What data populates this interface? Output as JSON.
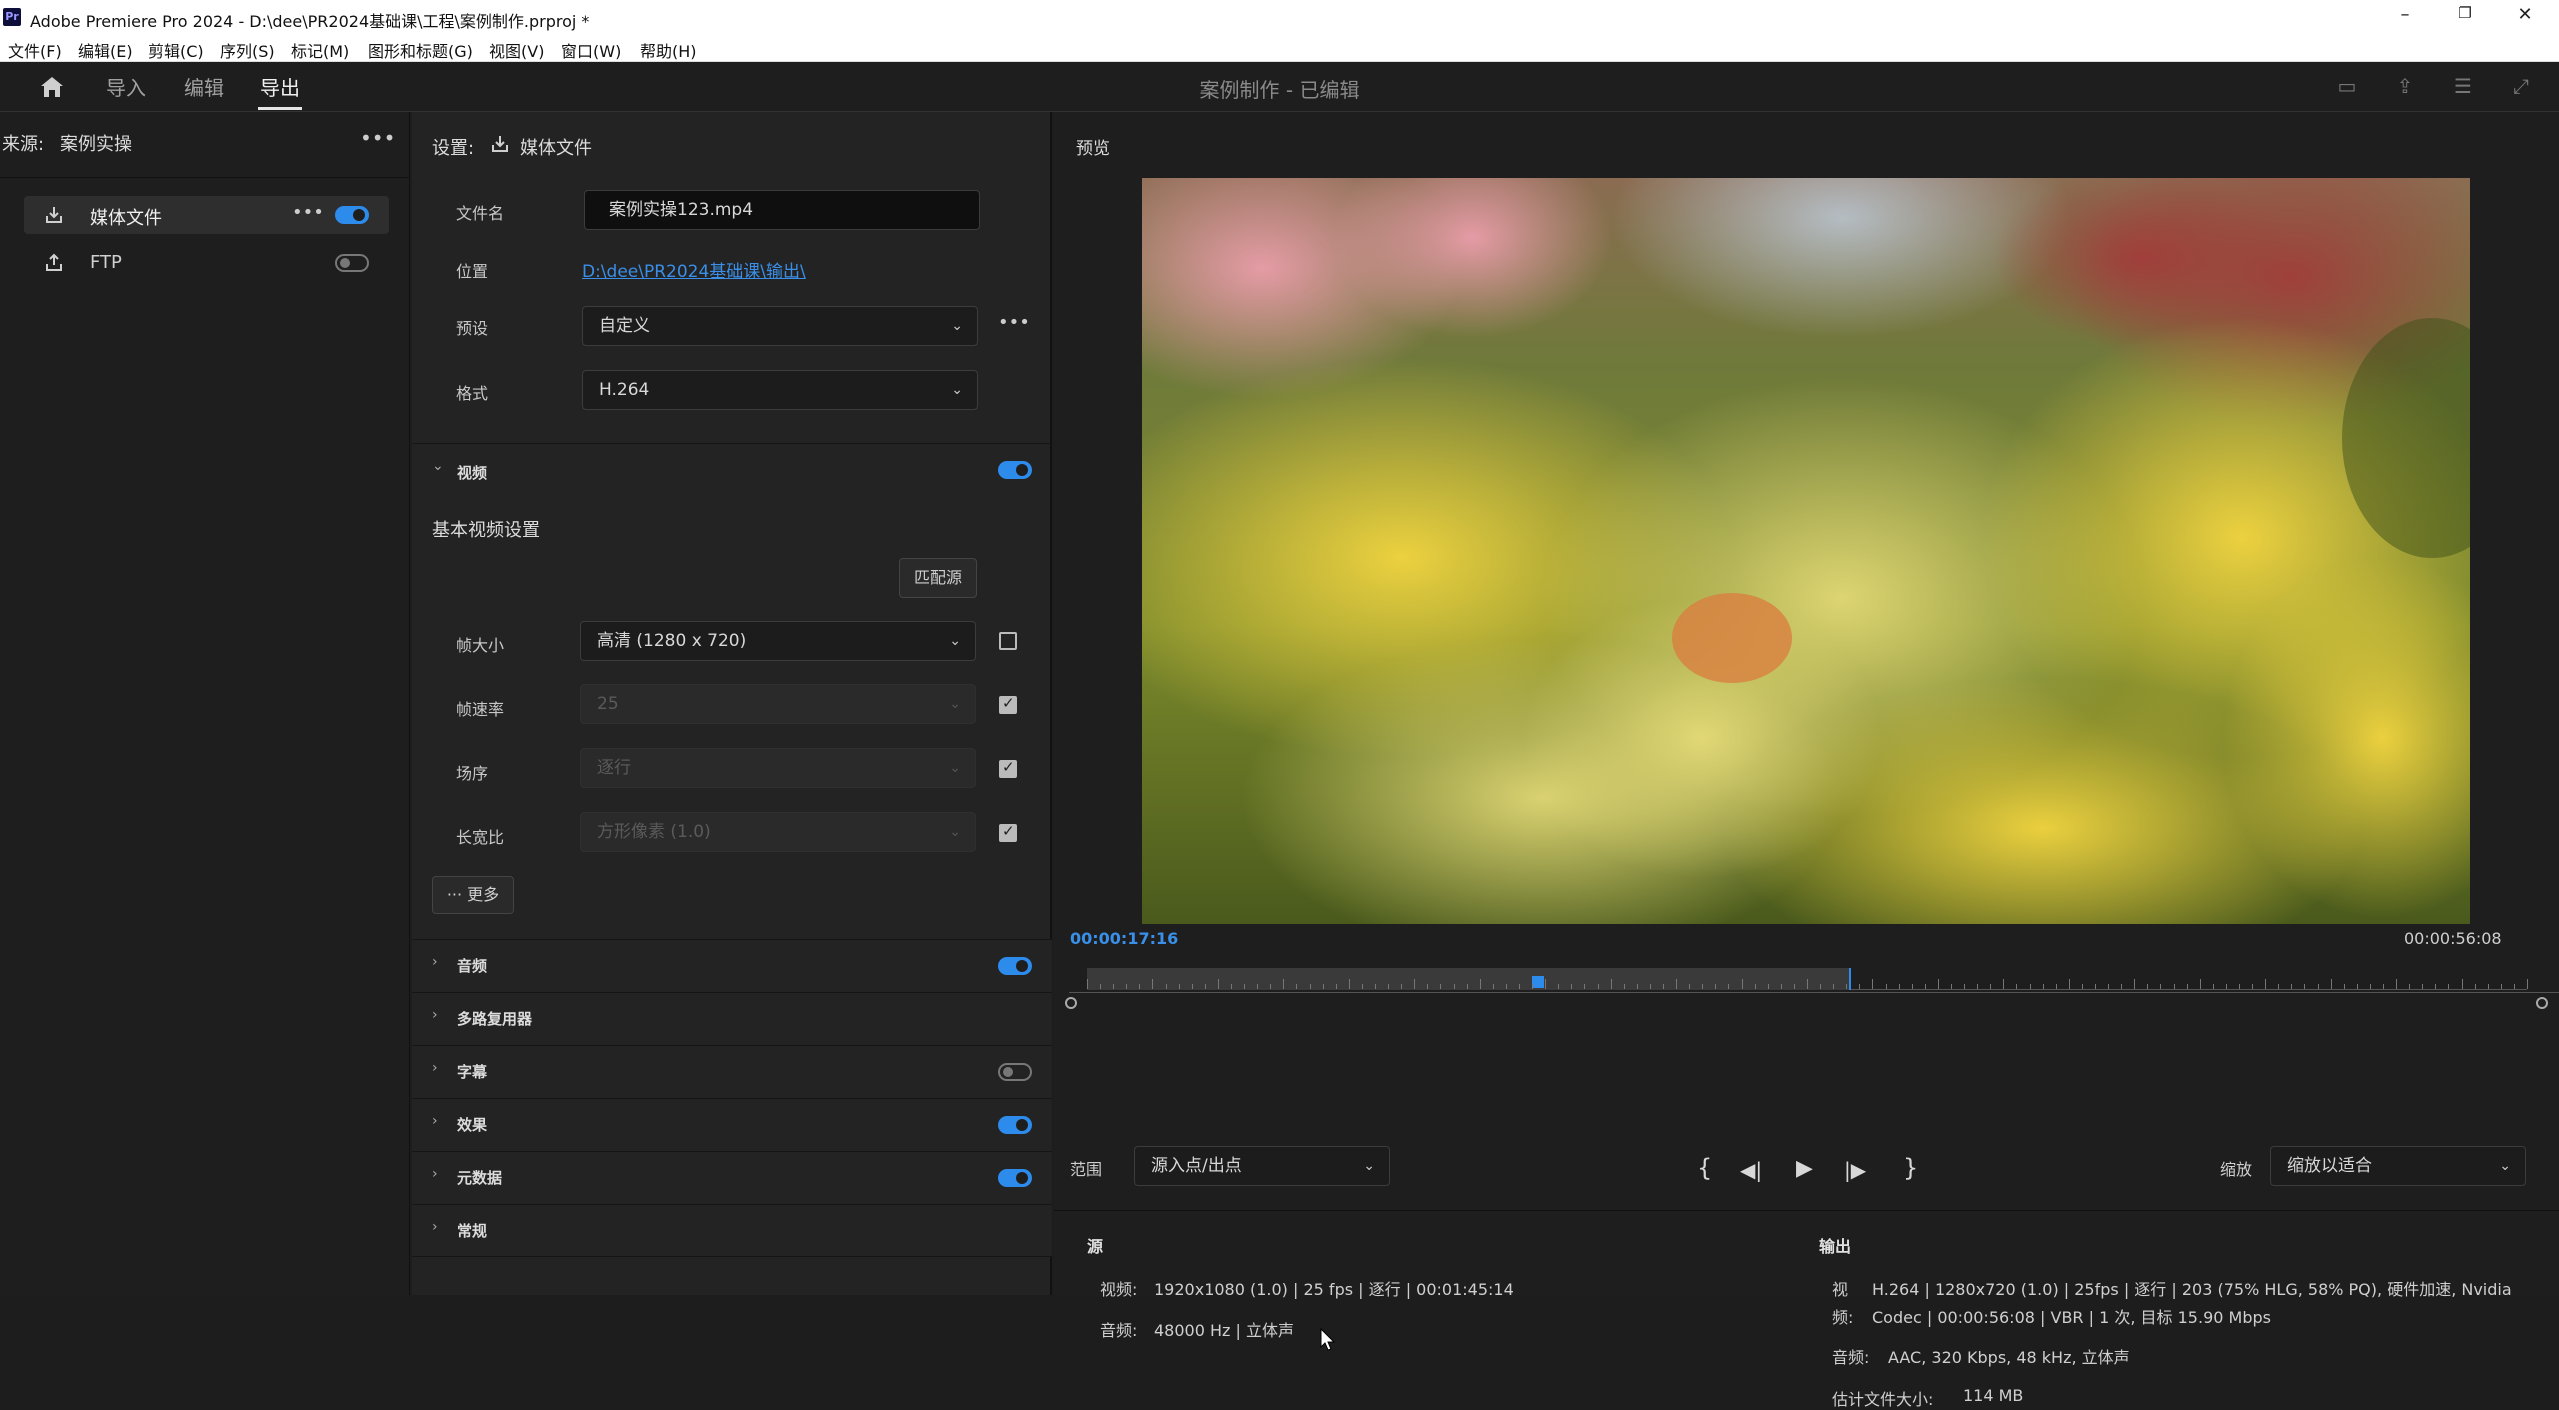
{
  "titlebar": {
    "app_icon": "Pr",
    "title": "Adobe Premiere Pro 2024 - D:\\dee\\PR2024基础课\\工程\\案例制作.prproj *"
  },
  "menu": [
    "文件(F)",
    "编辑(E)",
    "剪辑(C)",
    "序列(S)",
    "标记(M)",
    "图形和标题(G)",
    "视图(V)",
    "窗口(W)",
    "帮助(H)"
  ],
  "header": {
    "tabs": [
      "导入",
      "编辑",
      "导出"
    ],
    "active_tab": "导出",
    "doc_title": "案例制作 - 已编辑"
  },
  "source_panel": {
    "label": "来源:",
    "name": "案例实操",
    "items": [
      {
        "label": "媒体文件",
        "enabled": true
      },
      {
        "label": "FTP",
        "enabled": false
      }
    ]
  },
  "settings": {
    "label": "设置:",
    "target": "媒体文件",
    "filename_label": "文件名",
    "filename": "案例实操123.mp4",
    "location_label": "位置",
    "location": "D:\\dee\\PR2024基础课\\输出\\",
    "preset_label": "预设",
    "preset": "自定义",
    "format_label": "格式",
    "format": "H.264",
    "video_section": "视频",
    "basic_video": "基本视频设置",
    "match_source": "匹配源",
    "frame_size_label": "帧大小",
    "frame_size": "高清 (1280 x 720)",
    "frame_rate_label": "帧速率",
    "frame_rate": "25",
    "field_order_label": "场序",
    "field_order": "逐行",
    "aspect_label": "长宽比",
    "aspect": "方形像素 (1.0)",
    "more": "更多",
    "sections": [
      {
        "name": "音频",
        "toggle": "on"
      },
      {
        "name": "多路复用器",
        "toggle": "none"
      },
      {
        "name": "字幕",
        "toggle": "off"
      },
      {
        "name": "效果",
        "toggle": "on"
      },
      {
        "name": "元数据",
        "toggle": "on"
      },
      {
        "name": "常规",
        "toggle": "none"
      }
    ]
  },
  "preview": {
    "label": "预览",
    "current_time": "00:00:17:16",
    "duration": "00:00:56:08",
    "range_label": "范围",
    "range_value": "源入点/出点",
    "zoom_label": "缩放",
    "zoom_value": "缩放以适合",
    "playhead_fraction": 0.313,
    "out_point_fraction": 0.529
  },
  "source_info": {
    "title": "源",
    "video_label": "视频:",
    "video": "1920x1080 (1.0) | 25 fps | 逐行 | 00:01:45:14",
    "audio_label": "音频:",
    "audio": "48000 Hz | 立体声"
  },
  "output_info": {
    "title": "输出",
    "video_label_1": "视",
    "video_line1": "H.264 | 1280x720 (1.0) | 25fps | 逐行 | 203 (75% HLG, 58% PQ), 硬件加速, Nvidia",
    "video_label_2": "频:",
    "video_line2": "Codec | 00:00:56:08 | VBR | 1 次, 目标 15.90 Mbps",
    "audio_label": "音频:",
    "audio": "AAC, 320 Kbps, 48 kHz, 立体声",
    "size_label": "估计文件大小:",
    "size": "114 MB"
  }
}
